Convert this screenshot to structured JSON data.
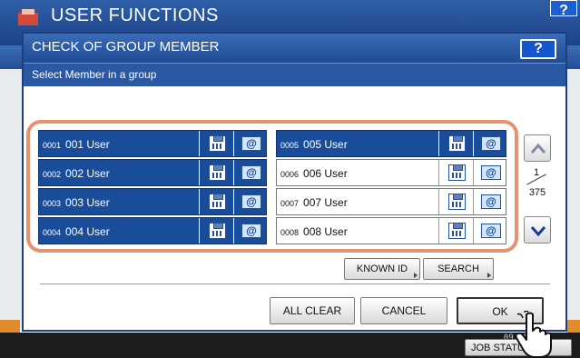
{
  "background": {
    "title": "USER FUNCTIONS",
    "help_label": "?",
    "time_line1": "",
    "time_line2": "09:25",
    "job_label": "JOB STATUS"
  },
  "dialog": {
    "title": "CHECK OF GROUP MEMBER",
    "help_label": "?",
    "subtitle": "Select Member in a group"
  },
  "members_left": [
    {
      "id": "0001",
      "name": "001 User",
      "selected": true
    },
    {
      "id": "0002",
      "name": "002 User",
      "selected": true
    },
    {
      "id": "0003",
      "name": "003 User",
      "selected": true
    },
    {
      "id": "0004",
      "name": "004 User",
      "selected": true
    }
  ],
  "members_right": [
    {
      "id": "0005",
      "name": "005 User",
      "selected": true
    },
    {
      "id": "0006",
      "name": "006 User",
      "selected": false
    },
    {
      "id": "0007",
      "name": "007 User",
      "selected": false
    },
    {
      "id": "0008",
      "name": "008 User",
      "selected": false
    }
  ],
  "icons": {
    "fax": "fax-icon",
    "email": "email-icon",
    "mail_glyph": "@"
  },
  "pagination": {
    "current": "1",
    "total": "375"
  },
  "buttons": {
    "known_id": "KNOWN ID",
    "search": "SEARCH",
    "all_clear": "ALL CLEAR",
    "cancel": "CANCEL",
    "ok": "OK"
  },
  "colors": {
    "selected_row": "#1a4d99",
    "highlight_frame": "#e59270",
    "title_bar": "#2a58a3"
  }
}
